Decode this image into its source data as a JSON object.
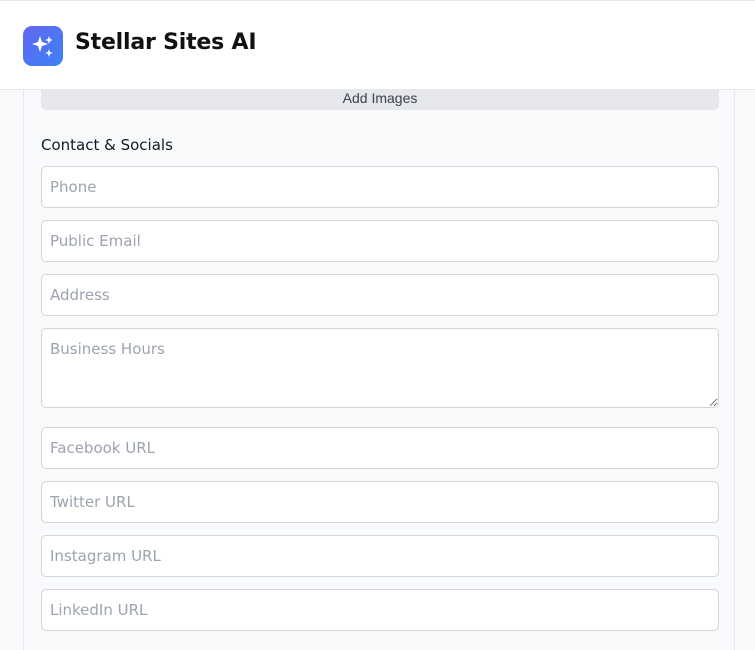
{
  "header": {
    "brand": "Stellar Sites AI",
    "logo_icon": "sparkles-icon",
    "accent": "#4f5ff0"
  },
  "form": {
    "add_images_label": "Add Images",
    "section_title": "Contact & Socials",
    "fields": {
      "phone": "Phone",
      "public_email": "Public Email",
      "address": "Address",
      "business_hours": "Business Hours",
      "facebook_url": "Facebook URL",
      "twitter_url": "Twitter URL",
      "instagram_url": "Instagram URL",
      "linkedin_url": "LinkedIn URL"
    }
  }
}
